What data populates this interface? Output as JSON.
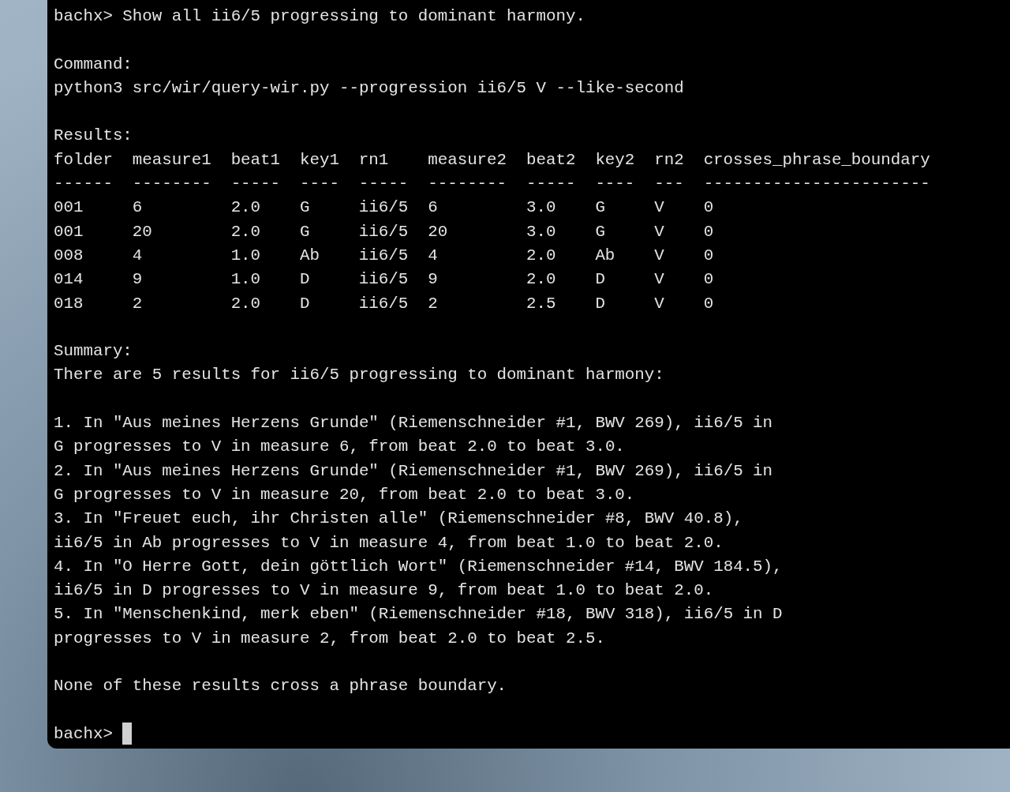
{
  "terminal": {
    "output": [
      {
        "kind": "prompt",
        "prompt": "bachx>",
        "text": "Show all ii6/5 progressing to dominant harmony."
      },
      {
        "kind": "blank"
      },
      {
        "kind": "text",
        "text": "Command:"
      },
      {
        "kind": "text",
        "text": "python3 src/wir/query-wir.py --progression ii6/5 V --like-second"
      },
      {
        "kind": "blank"
      },
      {
        "kind": "text",
        "text": "Results:"
      },
      {
        "kind": "table",
        "columns": [
          "folder",
          "measure1",
          "beat1",
          "key1",
          "rn1",
          "measure2",
          "beat2",
          "key2",
          "rn2",
          "crosses_phrase_boundary"
        ],
        "separators": [
          "------",
          "--------",
          "-----",
          "----",
          "-----",
          "--------",
          "-----",
          "----",
          "---",
          "-----------------------"
        ],
        "rows": [
          [
            "001",
            "6",
            "2.0",
            "G",
            "ii6/5",
            "6",
            "3.0",
            "G",
            "V",
            "0"
          ],
          [
            "001",
            "20",
            "2.0",
            "G",
            "ii6/5",
            "20",
            "3.0",
            "G",
            "V",
            "0"
          ],
          [
            "008",
            "4",
            "1.0",
            "Ab",
            "ii6/5",
            "4",
            "2.0",
            "Ab",
            "V",
            "0"
          ],
          [
            "014",
            "9",
            "1.0",
            "D",
            "ii6/5",
            "9",
            "2.0",
            "D",
            "V",
            "0"
          ],
          [
            "018",
            "2",
            "2.0",
            "D",
            "ii6/5",
            "2",
            "2.5",
            "D",
            "V",
            "0"
          ]
        ]
      },
      {
        "kind": "blank"
      },
      {
        "kind": "text",
        "text": "Summary:"
      },
      {
        "kind": "text",
        "text": "There are 5 results for ii6/5 progressing to dominant harmony:"
      },
      {
        "kind": "blank"
      },
      {
        "kind": "text",
        "text": "1. In \"Aus meines Herzens Grunde\" (Riemenschneider #1, BWV 269), ii6/5 in G progresses to V in measure 6, from beat 2.0 to beat 3.0."
      },
      {
        "kind": "text",
        "text": "2. In \"Aus meines Herzens Grunde\" (Riemenschneider #1, BWV 269), ii6/5 in G progresses to V in measure 20, from beat 2.0 to beat 3.0."
      },
      {
        "kind": "text",
        "text": "3. In \"Freuet euch, ihr Christen alle\" (Riemenschneider #8, BWV 40.8), ii6/5 in Ab progresses to V in measure 4, from beat 1.0 to beat 2.0."
      },
      {
        "kind": "text",
        "text": "4. In \"O Herre Gott, dein göttlich Wort\" (Riemenschneider #14, BWV 184.5), ii6/5 in D progresses to V in measure 9, from beat 1.0 to beat 2.0."
      },
      {
        "kind": "text",
        "text": "5. In \"Menschenkind, merk eben\" (Riemenschneider #18, BWV 318), ii6/5 in D progresses to V in measure 2, from beat 2.0 to beat 2.5."
      },
      {
        "kind": "blank"
      },
      {
        "kind": "text",
        "text": "None of these results cross a phrase boundary."
      },
      {
        "kind": "blank"
      },
      {
        "kind": "prompt",
        "prompt": "bachx>",
        "cursor": true
      }
    ]
  }
}
